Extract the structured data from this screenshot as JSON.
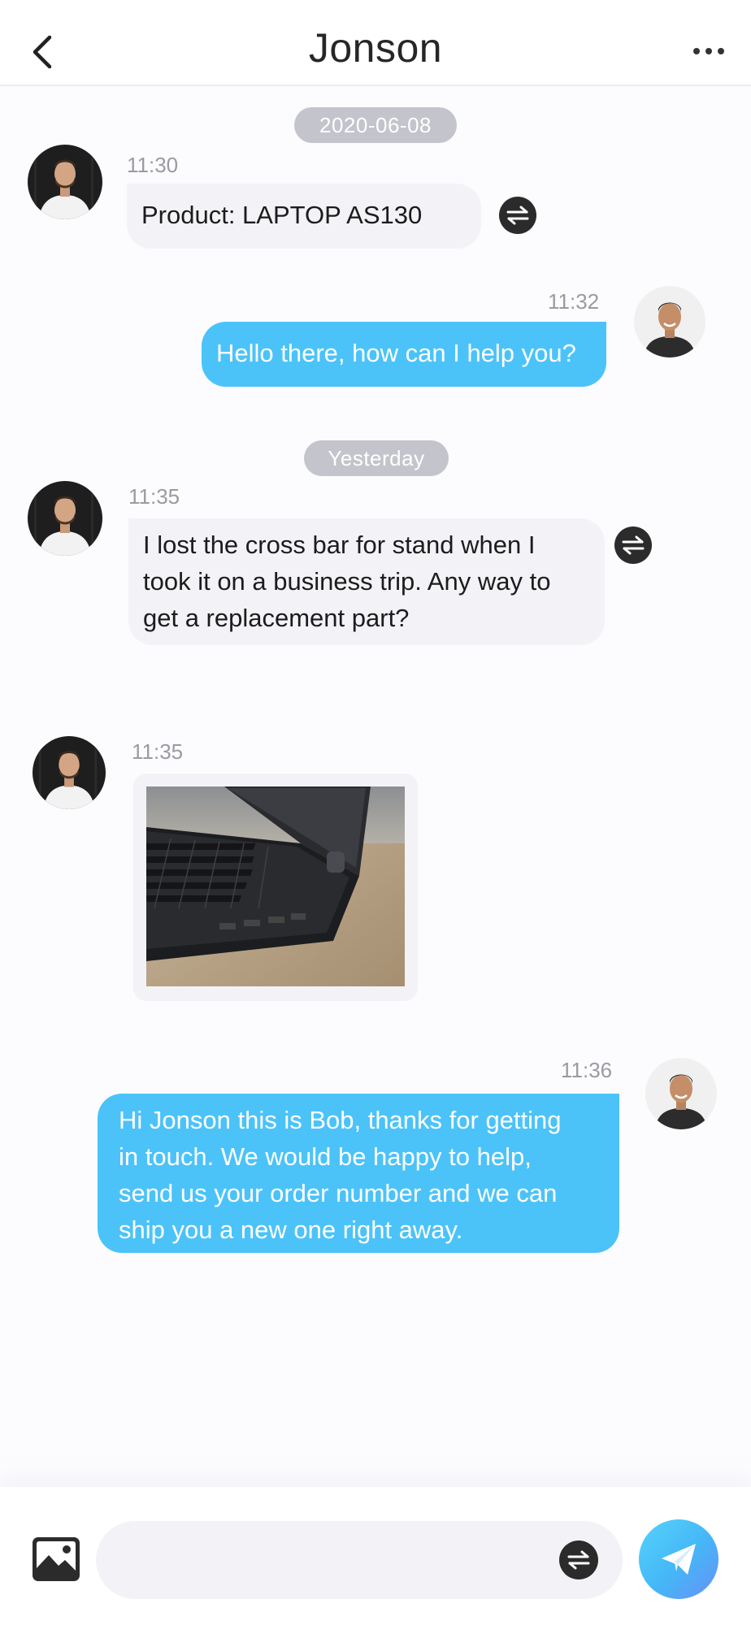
{
  "header": {
    "title": "Jonson",
    "back_icon": "chevron-left-icon",
    "more_icon": "more-horizontal-icon"
  },
  "messages": {
    "date_1": "2020-06-08",
    "msg1": {
      "time": "11:30",
      "text": "Product: LAPTOP AS130"
    },
    "msg2": {
      "time": "11:32",
      "text": "Hello there, how can I help you?"
    },
    "date_2": "Yesterday",
    "msg3": {
      "time": "11:35",
      "lines": [
        "I lost the cross bar for stand when I",
        "took it on a business trip. Any way to",
        "get a replacement part?"
      ]
    },
    "msg4": {
      "time": "11:35",
      "image": "laptop-photo"
    },
    "msg5": {
      "time": "11:36",
      "lines": [
        "Hi Jonson this is Bob, thanks for getting",
        "in touch. We would be happy to help,",
        "send us your order number and we can",
        "ship you a new one right away."
      ]
    }
  },
  "composer": {
    "placeholder": "",
    "value": "",
    "gallery_icon": "image-icon",
    "translate_icon": "translate-icon",
    "send_icon": "send-icon"
  },
  "colors": {
    "outgoing_bubble": "#4bc3f9",
    "incoming_bubble": "#f3f3f7",
    "date_pill": "#c4c4cc",
    "send_gradient_start": "#55d3fb",
    "send_gradient_end": "#6a8ff7"
  }
}
